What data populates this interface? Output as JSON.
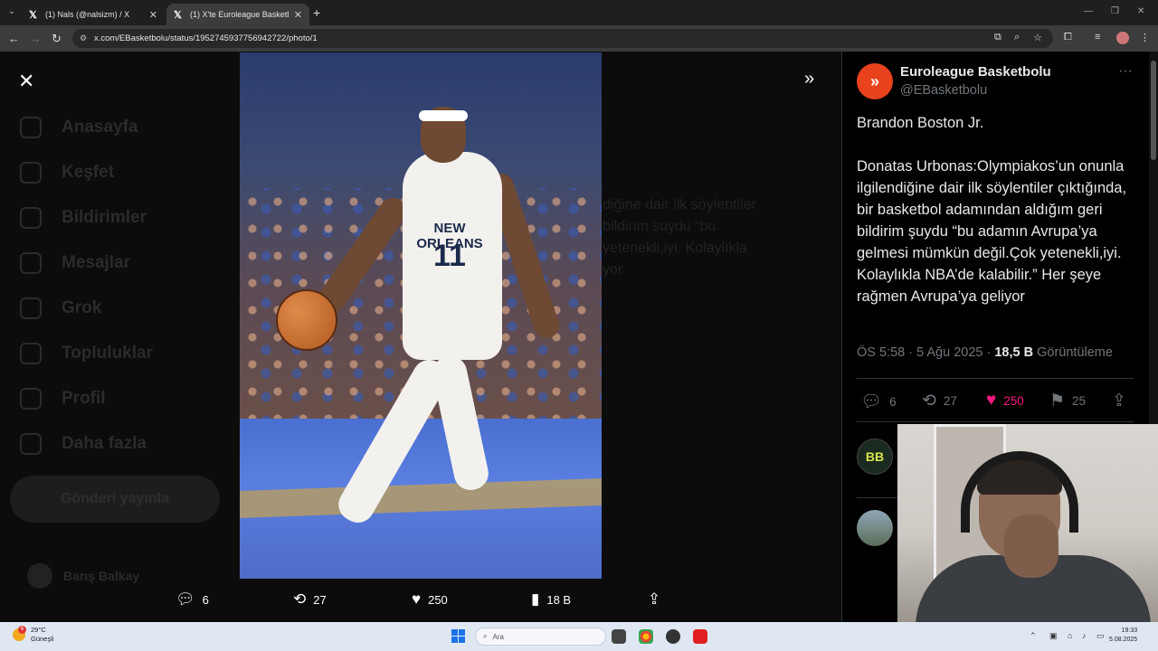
{
  "browser": {
    "tabs": [
      {
        "title": "(1) Nals (@nalsizm) / X",
        "active": false
      },
      {
        "title": "(1) X'te Euroleague Basketbolu",
        "active": true
      }
    ],
    "url": "x.com/EBasketbolu/status/1952745937756942722/photo/1"
  },
  "background_nav": {
    "items": [
      "Anasayfa",
      "Keşfet",
      "Bildirimler",
      "Mesajlar",
      "Grok",
      "Topluluklar",
      "Profil",
      "Daha fazla"
    ],
    "post_button": "Gönderi yayınla",
    "user_name": "Barış Balkay"
  },
  "background_text": "diğine dair ilk söylentiler\nbildirim şuydu “bu\nyetenekli,iyi. Kolaylıkla\nyor",
  "photo": {
    "jersey_text": "NEW ORLEANS",
    "jersey_number": "11"
  },
  "photo_actions": {
    "replies": "6",
    "reposts": "27",
    "likes": "250",
    "views": "18 B"
  },
  "tweet": {
    "avatar_text": "»",
    "display_name": "Euroleague Basketbolu",
    "handle": "@EBasketbolu",
    "body": "Brandon Boston Jr.\n\nDonatas Urbonas:Olympiakos’un onunla ilgilendiğine dair ilk söylentiler çıktığında, bir basketbol adamından aldığım geri bildirim şuydu “bu adamın Avrupa’ya gelmesi mümkün değil.Çok yetenekli,iyi. Kolaylıkla NBA’de kalabilir.” Her şeye rağmen Avrupa’ya geliyor",
    "time": "ÖS 5:58 · 5 Ağu 2025 · ",
    "views_count": "18,5 B",
    "views_label": " Görüntüleme",
    "replies": "6",
    "reposts": "27",
    "likes": "250",
    "bookmarks": "25",
    "reply_avatar_text": "BB"
  },
  "taskbar": {
    "temperature": "29°C",
    "condition": "Güneşli",
    "notification_count": "6",
    "search_placeholder": "Ara",
    "time": "19:33",
    "date": "5.08.2025"
  },
  "colors": {
    "like": "#f91880",
    "muted": "#71767b",
    "text": "#e7e9ea",
    "euroleague": "#e8431d"
  }
}
